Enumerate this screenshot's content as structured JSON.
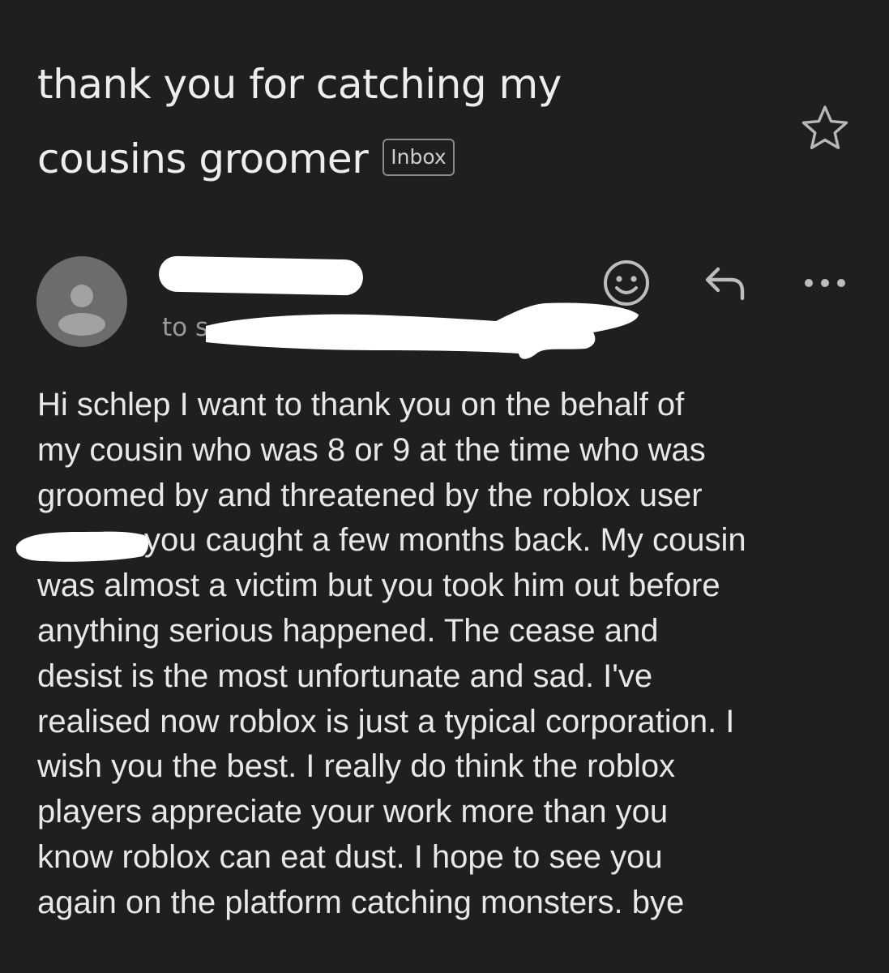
{
  "email": {
    "subject_lines": [
      "thank you for catching my",
      "cousins groomer"
    ],
    "label": "Inbox",
    "to_prefix": "to s",
    "body_lines": [
      "Hi schlep I want to thank you on the behalf of",
      "my cousin who was 8 or 9 at the time who was",
      "groomed by and threatened by the roblox user",
      "you caught a few months back. My cousin",
      "was almost a victim but you took him out before",
      "anything serious happened. The cease and",
      "desist is the most unfortunate and sad. I've",
      "realised now roblox is just a typical corporation. I",
      "wish you the best. I really do think the roblox",
      "players appreciate your work more than you",
      "know roblox can eat dust. I hope to see you",
      "again on the platform catching monsters. bye"
    ]
  },
  "icons": {
    "star": "star-icon",
    "avatar": "person-icon",
    "emoji": "smiley-icon",
    "reply": "reply-icon",
    "more": "more-horizontal-icon"
  },
  "colors": {
    "background": "#1f1f21",
    "text": "#e8e8e8",
    "muted": "#9a9a9a",
    "avatar": "#6c6c6e",
    "redaction": "#ffffff"
  }
}
